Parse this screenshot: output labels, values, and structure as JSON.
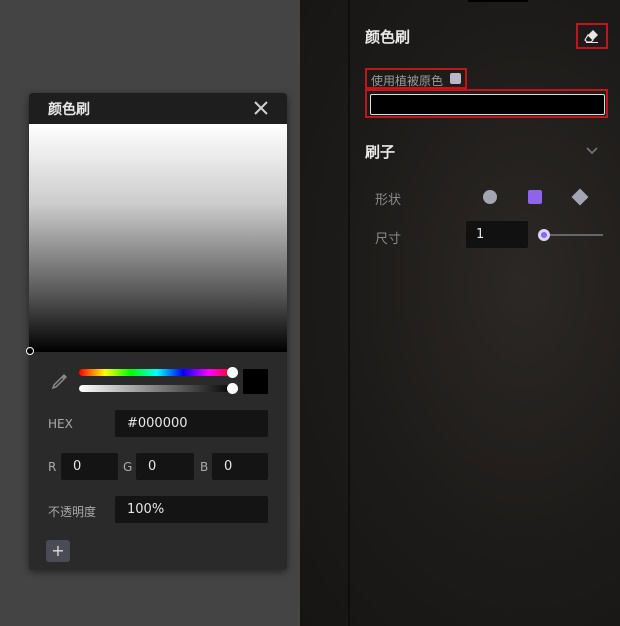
{
  "picker": {
    "title": "颜色刷",
    "hex_label": "HEX",
    "hex_value": "#000000",
    "r_label": "R",
    "r_value": "0",
    "g_label": "G",
    "g_value": "0",
    "b_label": "B",
    "b_value": "0",
    "opacity_label": "不透明度",
    "opacity_value": "100%",
    "add_label": "+",
    "current_color": "#000000",
    "hue": 0,
    "alpha_fraction": 1.0
  },
  "panel": {
    "title": "颜色刷",
    "eraser_icon": "eraser-icon",
    "use_original_label": "使用植被原色",
    "color_value": "#000000",
    "brush_title": "刷子",
    "shape_label": "形状",
    "shapes": [
      "circle",
      "square",
      "diamond"
    ],
    "selected_shape": "square",
    "size_label": "尺寸",
    "size_value": "1"
  },
  "colors": {
    "accent": "#8f63ea",
    "highlight_border": "#c0151c",
    "panel_bg": "#1d1b19",
    "page_bg": "#444444"
  }
}
